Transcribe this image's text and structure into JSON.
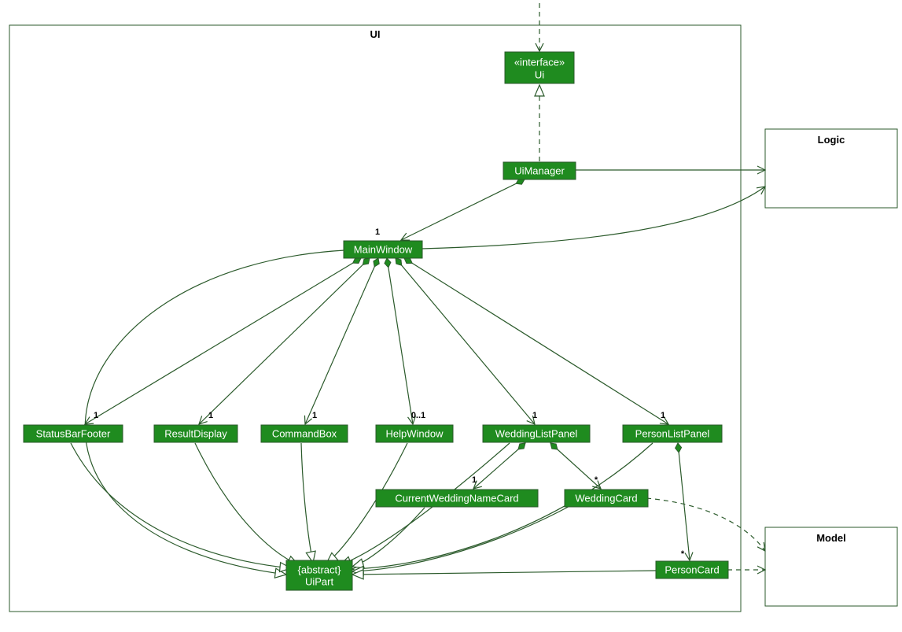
{
  "packages": {
    "ui": "UI",
    "logic": "Logic",
    "model": "Model"
  },
  "nodes": {
    "ui_interface": {
      "stereo": "«interface»",
      "name": "Ui"
    },
    "uimanager": "UiManager",
    "mainwindow": "MainWindow",
    "statusbarfooter": "StatusBarFooter",
    "resultdisplay": "ResultDisplay",
    "commandbox": "CommandBox",
    "helpwindow": "HelpWindow",
    "weddinglistpanel": "WeddingListPanel",
    "personlistpanel": "PersonListPanel",
    "currentweddingnamecard": "CurrentWeddingNameCard",
    "weddingcard": "WeddingCard",
    "personcard": "PersonCard",
    "uipart": {
      "stereo": "{abstract}",
      "name": "UiPart"
    }
  },
  "mult": {
    "mainwindow": "1",
    "statusbarfooter": "1",
    "resultdisplay": "1",
    "commandbox": "1",
    "helpwindow": "0..1",
    "weddinglistpanel": "1",
    "personlistpanel": "1",
    "currentweddingnamecard": "1",
    "weddingcard": "*",
    "personcard": "*"
  }
}
